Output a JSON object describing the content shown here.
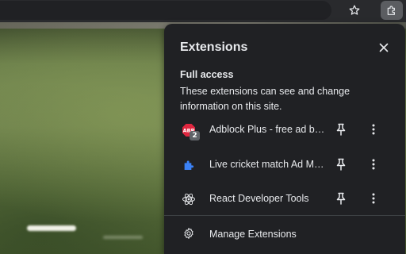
{
  "toolbar": {
    "bookmark_icon": "star-outline-icon",
    "extensions_icon": "puzzle-piece-icon"
  },
  "popup": {
    "title": "Extensions",
    "close_icon": "close-icon",
    "full_access": {
      "heading": "Full access",
      "description": "These extensions can see and change information on this site."
    },
    "extensions": [
      {
        "name": "Adblock Plus - free ad blocker",
        "icon": "adblock-plus-icon",
        "badge": "2"
      },
      {
        "name": "Live cricket match Ad Mute",
        "icon": "blue-puzzle-icon"
      },
      {
        "name": "React Developer Tools",
        "icon": "react-atom-icon"
      }
    ],
    "manage": {
      "label": "Manage Extensions",
      "icon": "gear-icon"
    }
  },
  "colors": {
    "popup_bg": "#202124",
    "text": "#e8eaed",
    "adblock_red": "#e0263f",
    "puzzle_blue": "#3b82f6"
  }
}
